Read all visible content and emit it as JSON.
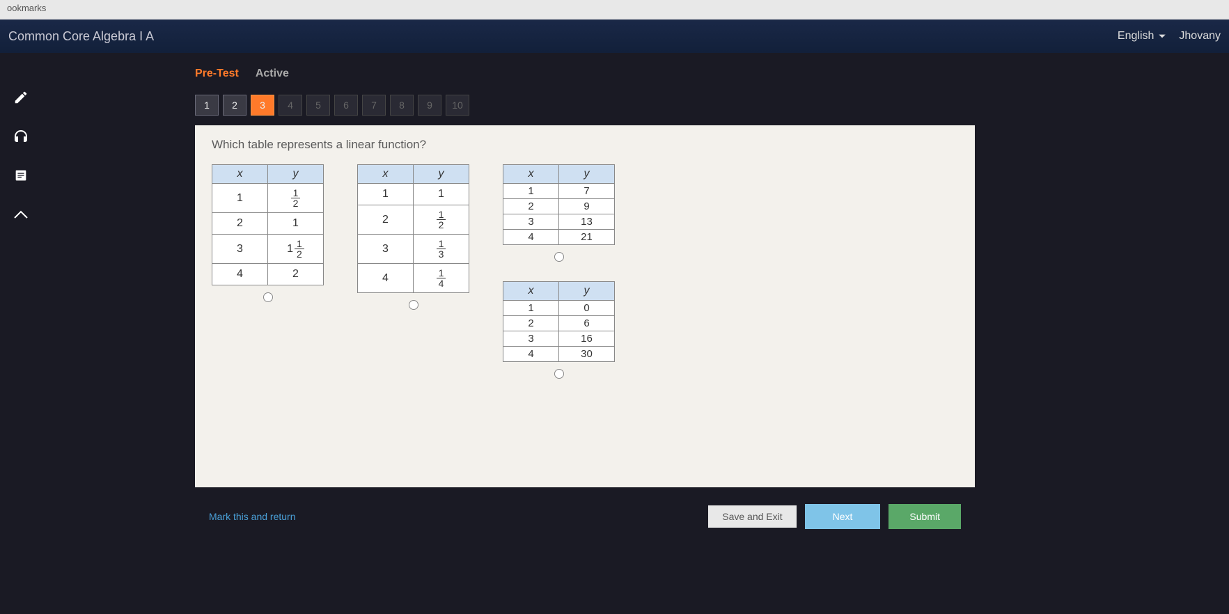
{
  "browser": {
    "bookmarks_label": "ookmarks"
  },
  "header": {
    "course_title": "Common Core Algebra I A",
    "language": "English",
    "user": "Jhovany"
  },
  "tabs": {
    "pretest": "Pre-Test",
    "active": "Active"
  },
  "qnav": [
    "1",
    "2",
    "3",
    "4",
    "5",
    "6",
    "7",
    "8",
    "9",
    "10"
  ],
  "question": {
    "prompt": "Which table represents a linear function?"
  },
  "tables": {
    "headers": {
      "x": "x",
      "y": "y"
    },
    "t1": {
      "rows": [
        {
          "x": "1",
          "y": {
            "type": "frac",
            "n": "1",
            "d": "2"
          }
        },
        {
          "x": "2",
          "y": {
            "type": "int",
            "v": "1"
          }
        },
        {
          "x": "3",
          "y": {
            "type": "mixed",
            "w": "1",
            "n": "1",
            "d": "2"
          }
        },
        {
          "x": "4",
          "y": {
            "type": "int",
            "v": "2"
          }
        }
      ]
    },
    "t2": {
      "rows": [
        {
          "x": "1",
          "y": {
            "type": "int",
            "v": "1"
          }
        },
        {
          "x": "2",
          "y": {
            "type": "frac",
            "n": "1",
            "d": "2"
          }
        },
        {
          "x": "3",
          "y": {
            "type": "frac",
            "n": "1",
            "d": "3"
          }
        },
        {
          "x": "4",
          "y": {
            "type": "frac",
            "n": "1",
            "d": "4"
          }
        }
      ]
    },
    "t3": {
      "rows": [
        {
          "x": "1",
          "y": "7"
        },
        {
          "x": "2",
          "y": "9"
        },
        {
          "x": "3",
          "y": "13"
        },
        {
          "x": "4",
          "y": "21"
        }
      ]
    },
    "t4": {
      "rows": [
        {
          "x": "1",
          "y": "0"
        },
        {
          "x": "2",
          "y": "6"
        },
        {
          "x": "3",
          "y": "16"
        },
        {
          "x": "4",
          "y": "30"
        }
      ]
    }
  },
  "footer": {
    "mark_return": "Mark this and return",
    "save_exit": "Save and Exit",
    "next": "Next",
    "submit": "Submit"
  }
}
